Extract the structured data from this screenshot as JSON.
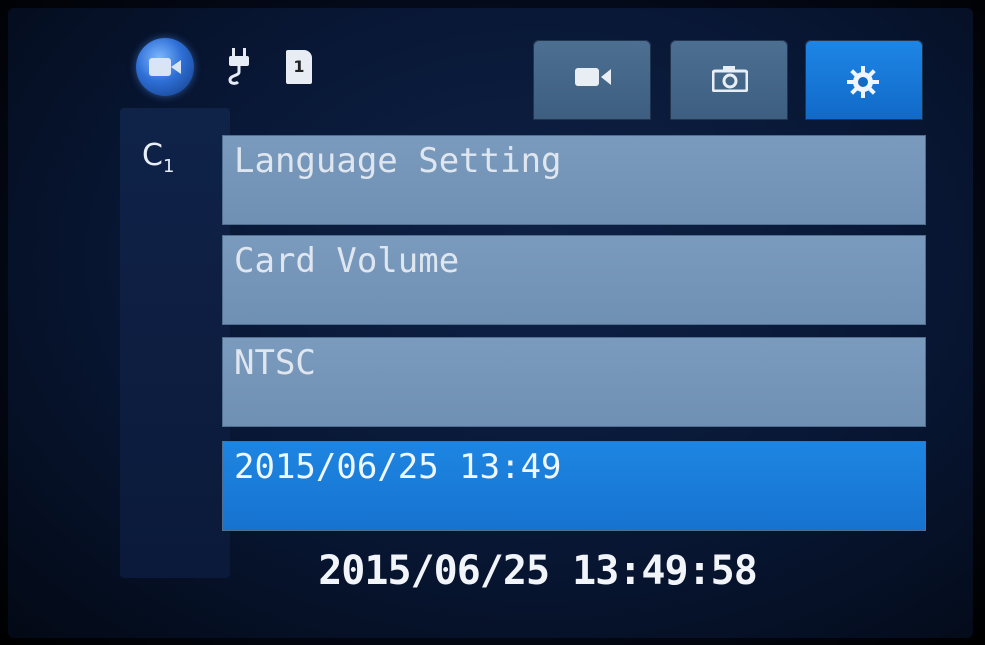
{
  "status_bar": {
    "mode_icon": "video-camera-icon",
    "power_icon": "power-plug-icon",
    "sd_card_icon": "sd-card-icon",
    "sd_card_number": "1"
  },
  "tabs": [
    {
      "name": "video",
      "icon": "video-camera-icon",
      "active": false
    },
    {
      "name": "photo",
      "icon": "photo-camera-icon",
      "active": false
    },
    {
      "name": "settings",
      "icon": "gear-icon",
      "active": true
    }
  ],
  "loop_label": {
    "symbol": "C",
    "index": "1"
  },
  "menu": {
    "items": [
      {
        "label": "Language Setting",
        "selected": false
      },
      {
        "label": "Card Volume",
        "selected": false
      },
      {
        "label": "NTSC",
        "selected": false
      },
      {
        "label": "2015/06/25 13:49",
        "selected": true
      }
    ]
  },
  "footer": {
    "datetime": "2015/06/25 13:49:58"
  },
  "colors": {
    "accent": "#1d86e2",
    "menu_item": "#7a9bbd",
    "tab_inactive": "#4c6f92",
    "background": "#081633"
  }
}
